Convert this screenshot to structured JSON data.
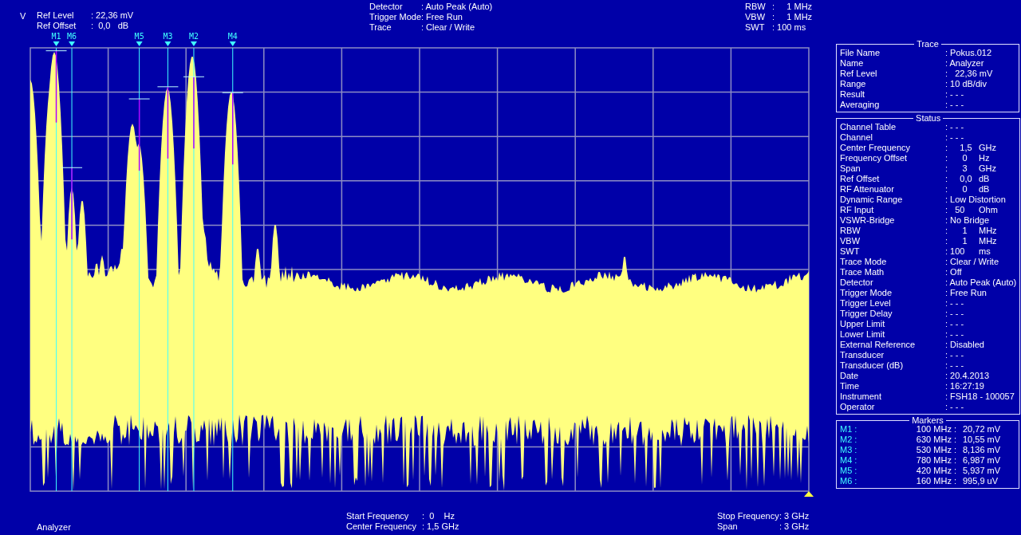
{
  "header": {
    "unit": "V",
    "left": [
      {
        "label": "Ref Level",
        "value": ": 22,36 mV"
      },
      {
        "label": "Ref Offset",
        "value": ":  0,0   dB"
      }
    ],
    "center": [
      {
        "label": "Detector",
        "value": ": Auto Peak (Auto)"
      },
      {
        "label": "Trigger Mode",
        "value": ": Free Run"
      },
      {
        "label": "Trace",
        "value": ": Clear / Write"
      }
    ],
    "right": [
      {
        "label": "RBW",
        "value": ":     1 MHz"
      },
      {
        "label": "VBW",
        "value": ":     1 MHz"
      },
      {
        "label": "SWT",
        "value": ": 100 ms"
      }
    ]
  },
  "plot": {
    "markers": [
      {
        "label": "M1"
      },
      {
        "label": "M6"
      },
      {
        "label": "M5"
      },
      {
        "label": "M3"
      },
      {
        "label": "M2"
      },
      {
        "label": "M4"
      }
    ]
  },
  "footer": {
    "mode": "Analyzer",
    "center": [
      {
        "label": "Start Frequency",
        "value": ":  0    Hz"
      },
      {
        "label": "Center Frequency",
        "value": ": 1,5 GHz"
      }
    ],
    "right": [
      {
        "label": "Stop Frequency",
        "value": ": 3 GHz"
      },
      {
        "label": "Span",
        "value": ": 3 GHz"
      }
    ]
  },
  "panels": [
    {
      "title": "Trace",
      "rows": [
        {
          "label": "File Name",
          "value": ": Pokus.012"
        },
        {
          "label": "Name",
          "value": ": Analyzer"
        },
        {
          "label": "Ref Level",
          "value": ":   22,36 mV"
        },
        {
          "label": "Range",
          "value": ": 10 dB/div"
        },
        {
          "label": "Result",
          "value": ": - - -"
        },
        {
          "label": "Averaging",
          "value": ": - - -"
        }
      ]
    },
    {
      "title": "Status",
      "rows": [
        {
          "label": "Channel Table",
          "value": ": - - -"
        },
        {
          "label": "Channel",
          "value": ": - - -"
        },
        {
          "label": "Center Frequency",
          "value": ":     1,5",
          "unit": "GHz"
        },
        {
          "label": "Frequency Offset",
          "value": ":      0",
          "unit": "Hz"
        },
        {
          "label": "Span",
          "value": ":      3",
          "unit": "GHz"
        },
        {
          "label": "Ref Offset",
          "value": ":     0,0",
          "unit": "dB"
        },
        {
          "label": "RF Attenuator",
          "value": ":      0",
          "unit": "dB"
        },
        {
          "label": "Dynamic Range",
          "value": ": Low Distortion"
        },
        {
          "label": "RF Input",
          "value": ":   50",
          "unit": "Ohm"
        },
        {
          "label": "VSWR-Bridge",
          "value": ": No Bridge"
        },
        {
          "label": "RBW",
          "value": ":      1",
          "unit": "MHz"
        },
        {
          "label": "VBW",
          "value": ":      1",
          "unit": "MHz"
        },
        {
          "label": "SWT",
          "value": ": 100",
          "unit": "ms"
        },
        {
          "label": "Trace Mode",
          "value": ": Clear / Write"
        },
        {
          "label": "Trace Math",
          "value": ": Off"
        },
        {
          "label": "Detector",
          "value": ": Auto Peak (Auto)"
        },
        {
          "label": "Trigger Mode",
          "value": ": Free Run"
        },
        {
          "label": "Trigger Level",
          "value": ": - - -"
        },
        {
          "label": "Trigger Delay",
          "value": ": - - -"
        },
        {
          "label": "Upper Limit",
          "value": ": - - -"
        },
        {
          "label": "Lower Limit",
          "value": ": - - -"
        },
        {
          "label": "External Reference",
          "value": ": Disabled"
        },
        {
          "label": "Transducer",
          "value": ": - - -"
        },
        {
          "label": "Transducer (dB)",
          "value": ": - - -"
        },
        {
          "label": "Date",
          "value": ": 20.4.2013"
        },
        {
          "label": "Time",
          "value": ": 16:27:19"
        },
        {
          "label": "Instrument",
          "value": ": FSH18 - 100057"
        },
        {
          "label": "Operator",
          "value": ": - - -"
        }
      ]
    }
  ],
  "markers": {
    "title": "Markers",
    "rows": [
      {
        "label": "M1 :",
        "frequency": "100 MHz :",
        "value": "20,72 mV"
      },
      {
        "label": "M2 :",
        "frequency": "630 MHz :",
        "value": "10,55 mV"
      },
      {
        "label": "M3 :",
        "frequency": "530 MHz :",
        "value": "8,136 mV"
      },
      {
        "label": "M4 :",
        "frequency": "780 MHz :",
        "value": "6,987 mV"
      },
      {
        "label": "M5 :",
        "frequency": "420 MHz :",
        "value": "5,937 mV"
      },
      {
        "label": "M6 :",
        "frequency": "160 MHz :",
        "value": "995,9 uV"
      }
    ]
  }
}
